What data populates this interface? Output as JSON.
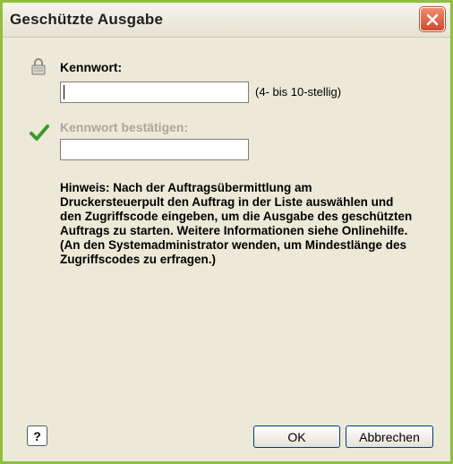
{
  "dialog": {
    "title": "Geschützte Ausgabe",
    "close_icon": "close-icon"
  },
  "password": {
    "label": "Kennwort:",
    "value": "",
    "length_hint": "(4- bis 10-stellig)",
    "icon": "lock-icon"
  },
  "confirm": {
    "label": "Kennwort bestätigen:",
    "value": "",
    "icon": "checkmark-icon"
  },
  "note": "Hinweis: Nach der Auftragsübermittlung am Druckersteuerpult den Auftrag in der Liste auswählen und den Zugriffscode eingeben, um die Ausgabe des geschützten Auftrags zu starten. Weitere Informationen siehe Onlinehilfe. (An den Systemadministrator wenden, um Mindestlänge des Zugriffscodes zu erfragen.)",
  "buttons": {
    "help": "?",
    "ok": "OK",
    "cancel": "Abbrechen"
  },
  "colors": {
    "frame": "#8fbf3f",
    "dialog_bg": "#ece9d8",
    "close_red": "#d24a2c",
    "check_green": "#3a9a2a",
    "disabled_text": "#a9a79b"
  }
}
